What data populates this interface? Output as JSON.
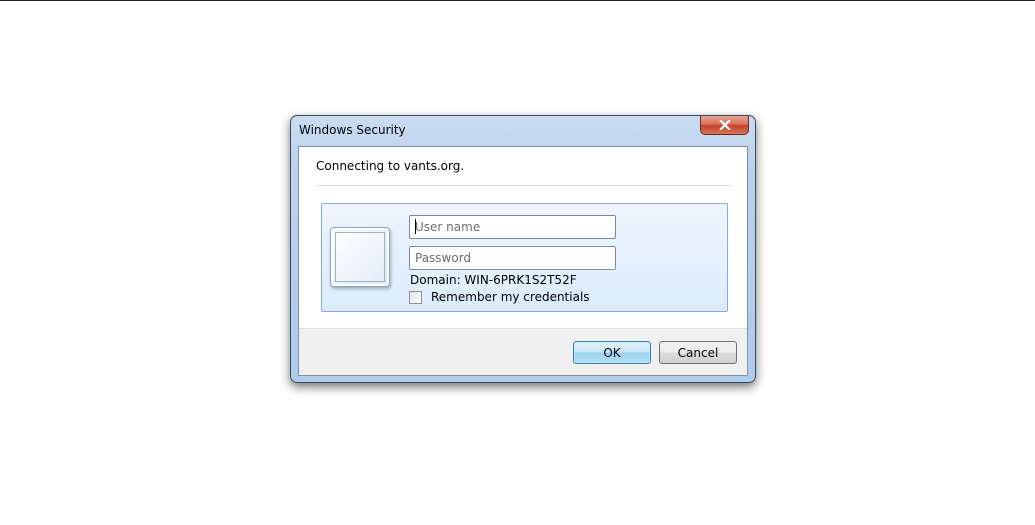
{
  "dialog": {
    "title": "Windows Security",
    "close_icon": "close-x-icon",
    "message": "Connecting to vants.org.",
    "credentials": {
      "user_icon": "user-tile-icon",
      "username_placeholder": "User name",
      "username_value": "",
      "password_placeholder": "Password",
      "password_value": "",
      "domain_text": "Domain: WIN-6PRK1S2T52F",
      "remember_label": "Remember my credentials",
      "remember_checked": false
    },
    "buttons": {
      "ok": "OK",
      "cancel": "Cancel"
    },
    "colors": {
      "accent": "#3c7fb1",
      "close_button": "#c6402a",
      "frame": "#bcd2ec"
    }
  }
}
